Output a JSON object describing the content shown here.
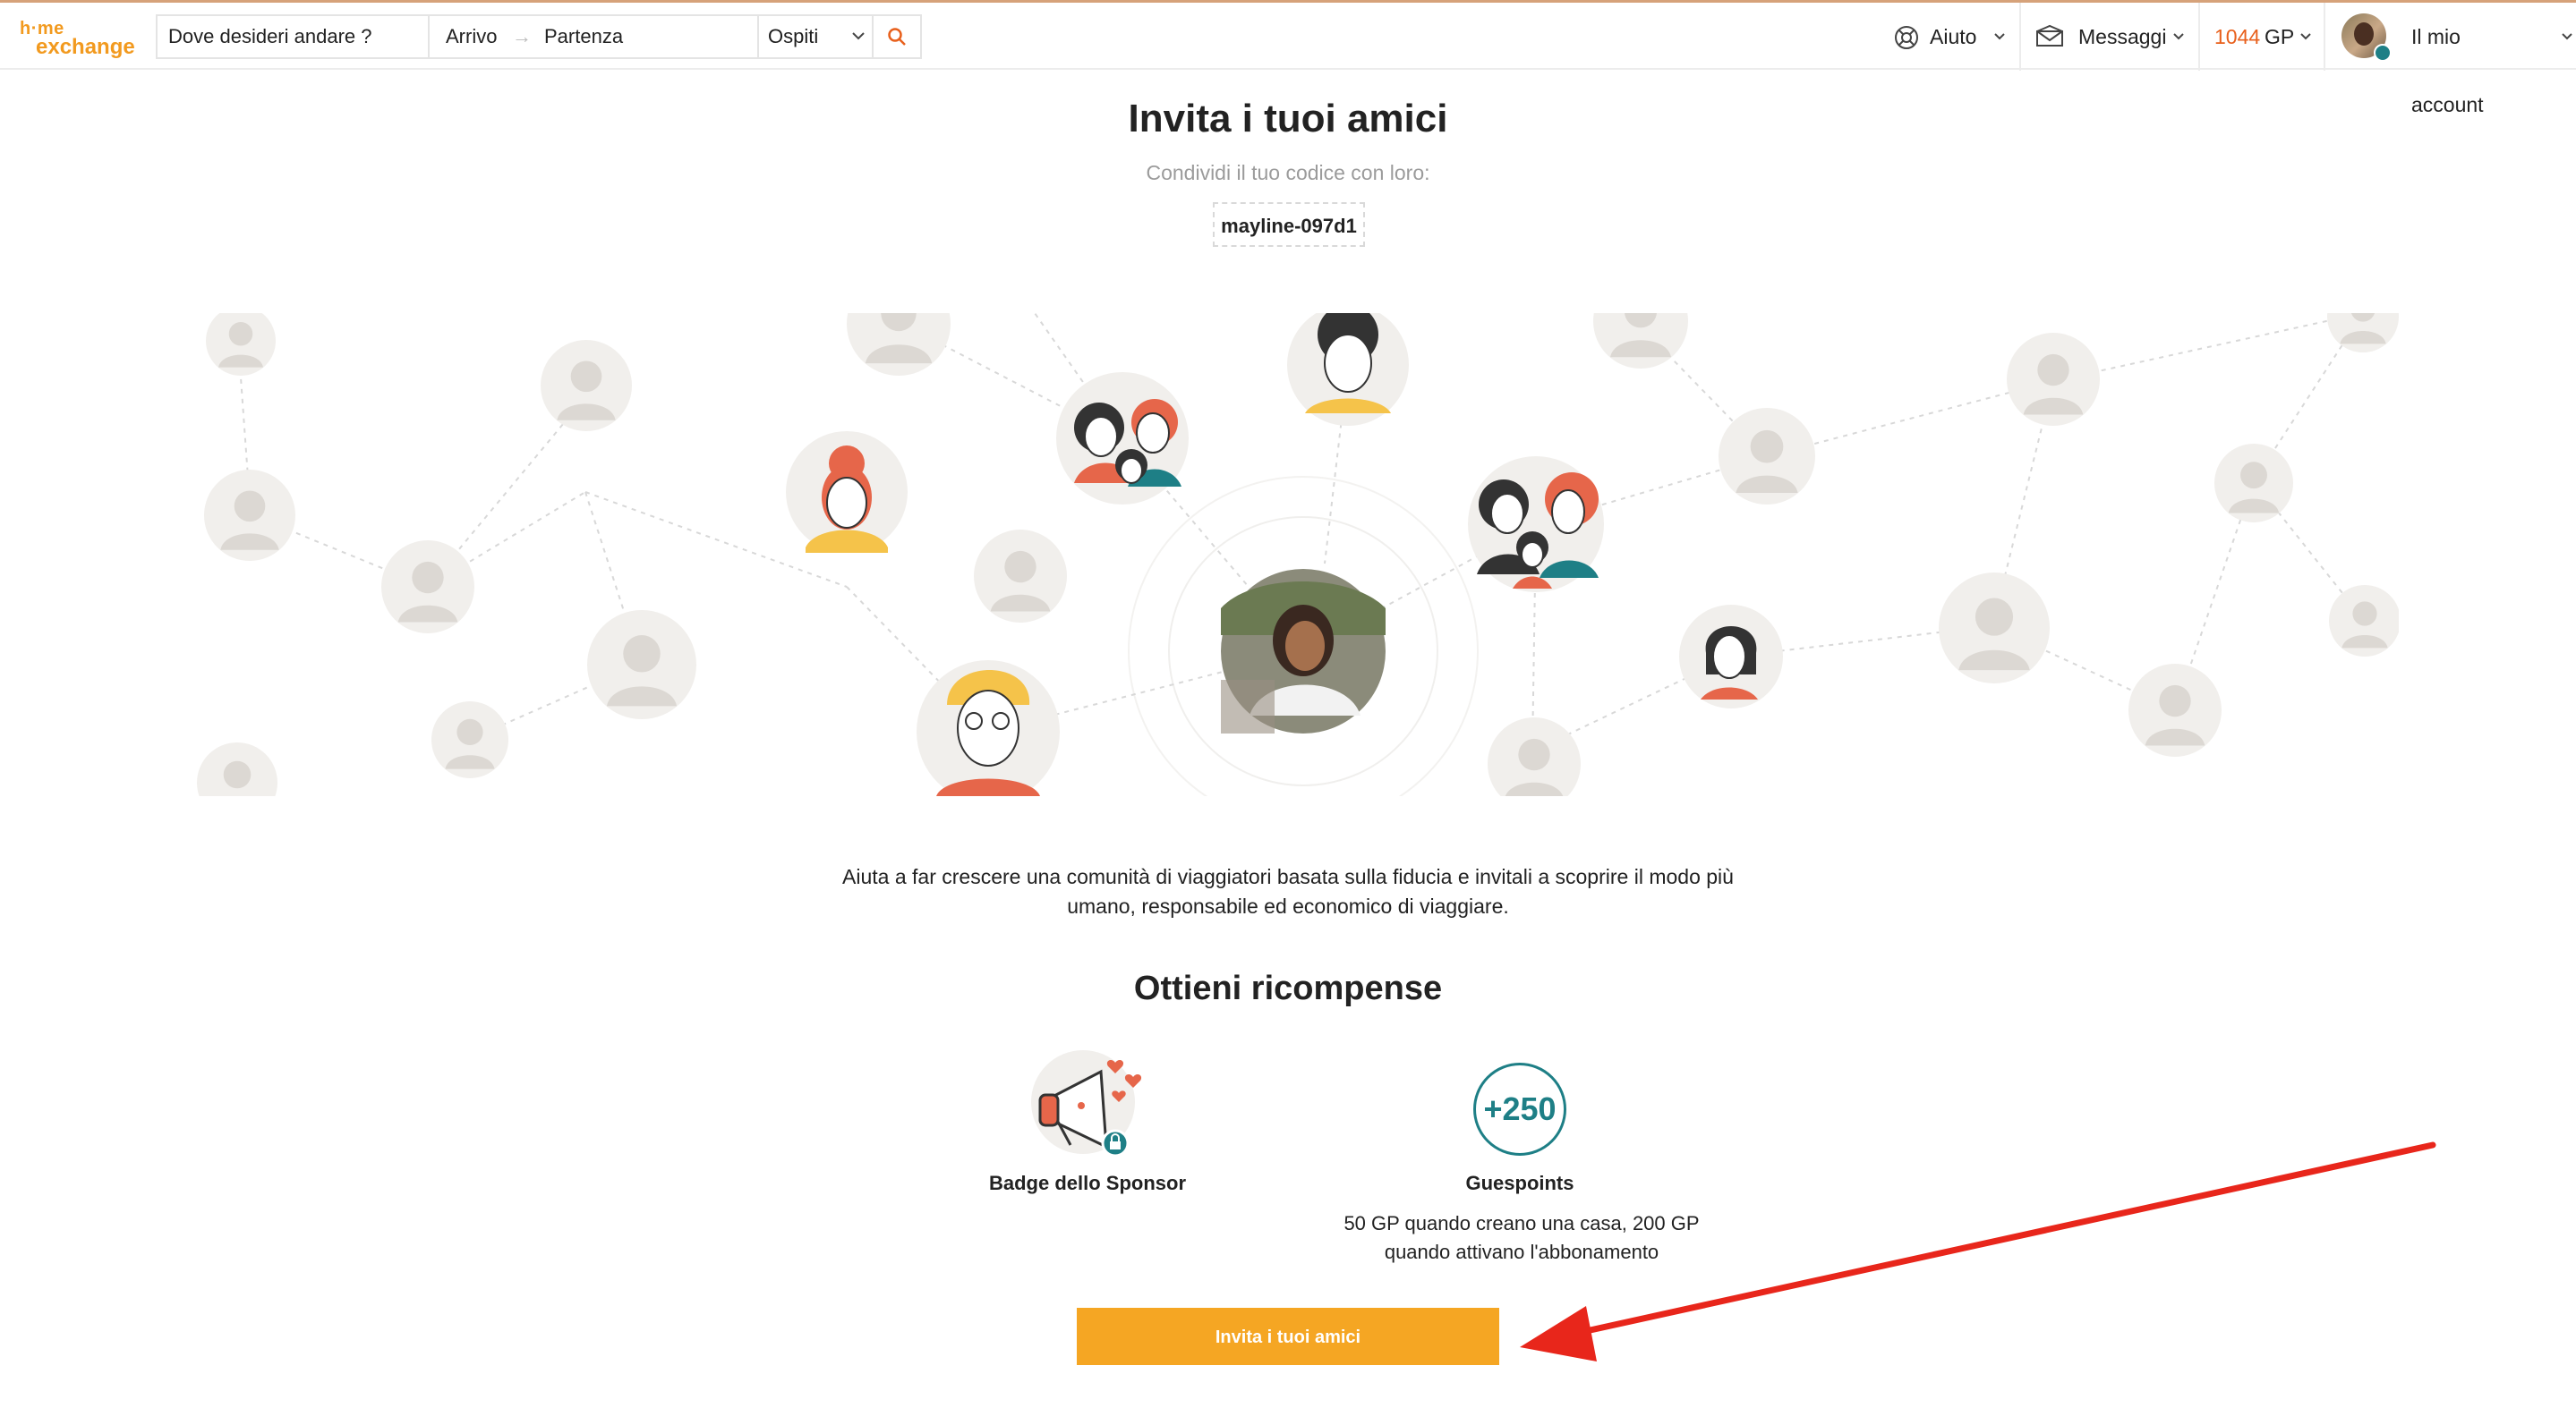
{
  "header": {
    "logo_line1": "h·me",
    "logo_line2": "exchange",
    "search": {
      "destination_placeholder": "Dove desideri andare ?",
      "arrival": "Arrivo",
      "arrow": "→",
      "departure": "Partenza",
      "guests": "Ospiti"
    },
    "nav": {
      "help": "Aiuto",
      "messages": "Messaggi",
      "guestpoints": "1044",
      "guestpoints_unit": "GP",
      "account": "Il mio account"
    }
  },
  "invite": {
    "title": "Invita i tuoi amici",
    "subtitle": "Condividi il tuo codice con loro:",
    "code": "mayline-097d1",
    "description_line1": "Aiuta a far crescere una comunità di viaggiatori basata sulla fiducia e invitali a scoprire il modo più",
    "description_line2": "umano, responsabile ed economico di viaggiare."
  },
  "rewards": {
    "title": "Ottieni ricompense",
    "badge_label": "Badge dello Sponsor",
    "points_badge": "+250",
    "points_label": "Guespoints",
    "points_desc_line1": "50 GP quando creano una casa, 200 GP",
    "points_desc_line2": "quando attivano l'abbonamento"
  },
  "cta": {
    "label": "Invita i tuoi amici"
  },
  "colors": {
    "accent_orange": "#f5a623",
    "brand_orange": "#f29a1f",
    "teal": "#1e7f86",
    "annotation_red": "#e8261b"
  },
  "icons": [
    "search-icon",
    "lifebuoy-icon",
    "envelope-icon",
    "chevron-down-icon",
    "megaphone-icon",
    "lock-icon",
    "heart-icon",
    "user-placeholder-icon"
  ]
}
